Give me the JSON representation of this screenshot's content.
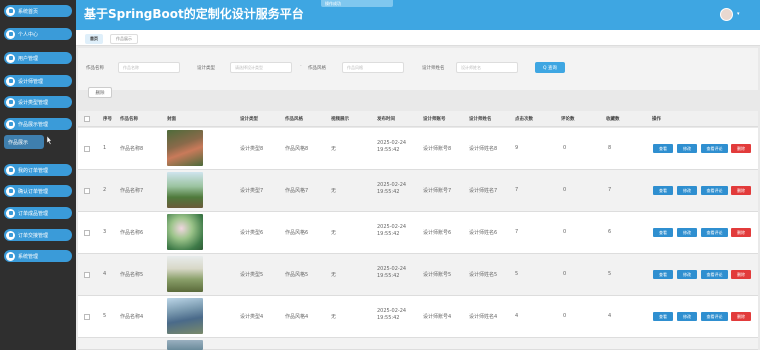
{
  "header": {
    "title": "基于SpringBoot的定制化设计服务平台",
    "toast": "操作成功"
  },
  "sidebar": {
    "items": [
      {
        "label": "系统首页"
      },
      {
        "label": "个人中心"
      },
      {
        "label": "用户管理"
      },
      {
        "label": "设计师管理"
      },
      {
        "label": "设计类型管理"
      },
      {
        "label": "作品展示管理"
      },
      {
        "label": "我的订单管理"
      },
      {
        "label": "确认订单管理"
      },
      {
        "label": "订单成品管理"
      },
      {
        "label": "订单交接管理"
      },
      {
        "label": "系统管理"
      }
    ],
    "submenu": {
      "label": "作品展示"
    }
  },
  "tabs": [
    {
      "label": "首页"
    },
    {
      "label": "作品展示"
    }
  ],
  "search": {
    "fields": [
      {
        "label": "作品名称",
        "placeholder": "作品名称"
      },
      {
        "label": "设计类型",
        "placeholder": "请选择设计类型"
      },
      {
        "label": "作品风格",
        "placeholder": "作品风格"
      },
      {
        "label": "设计师姓名",
        "placeholder": "设计师姓名"
      }
    ],
    "search_button": "Q 查询",
    "delete_button": "删除"
  },
  "table": {
    "columns": [
      "序号",
      "作品名称",
      "封面",
      "设计类型",
      "作品风格",
      "视频展示",
      "发布时间",
      "设计师账号",
      "设计师姓名",
      "点击次数",
      "评论数",
      "收藏数",
      "操作"
    ],
    "rows": [
      {
        "no": "1",
        "name": "作品名称8",
        "type": "设计类型8",
        "style": "作品风格8",
        "video": "无",
        "time": "2025-02-24 19:55:42",
        "account": "设计师账号8",
        "designer": "设计师姓名8",
        "clicks": "9",
        "comments": "0",
        "favs": "8"
      },
      {
        "no": "2",
        "name": "作品名称7",
        "type": "设计类型7",
        "style": "作品风格7",
        "video": "无",
        "time": "2025-02-24 19:55:42",
        "account": "设计师账号7",
        "designer": "设计师姓名7",
        "clicks": "7",
        "comments": "0",
        "favs": "7"
      },
      {
        "no": "3",
        "name": "作品名称6",
        "type": "设计类型6",
        "style": "作品风格6",
        "video": "无",
        "time": "2025-02-24 19:55:42",
        "account": "设计师账号6",
        "designer": "设计师姓名6",
        "clicks": "7",
        "comments": "0",
        "favs": "6"
      },
      {
        "no": "4",
        "name": "作品名称5",
        "type": "设计类型5",
        "style": "作品风格5",
        "video": "无",
        "time": "2025-02-24 19:55:42",
        "account": "设计师账号5",
        "designer": "设计师姓名5",
        "clicks": "5",
        "comments": "0",
        "favs": "5"
      },
      {
        "no": "5",
        "name": "作品名称4",
        "type": "设计类型4",
        "style": "作品风格4",
        "video": "无",
        "time": "2025-02-24 19:55:42",
        "account": "设计师账号4",
        "designer": "设计师姓名4",
        "clicks": "4",
        "comments": "0",
        "favs": "4"
      }
    ],
    "actions": {
      "view": "查看",
      "edit": "修改",
      "view_comments": "查看评论",
      "delete": "删除"
    }
  },
  "colors": {
    "accent": "#3ea6e2",
    "sidebar_bg": "#2f2f2f",
    "danger": "#e23b3b"
  }
}
